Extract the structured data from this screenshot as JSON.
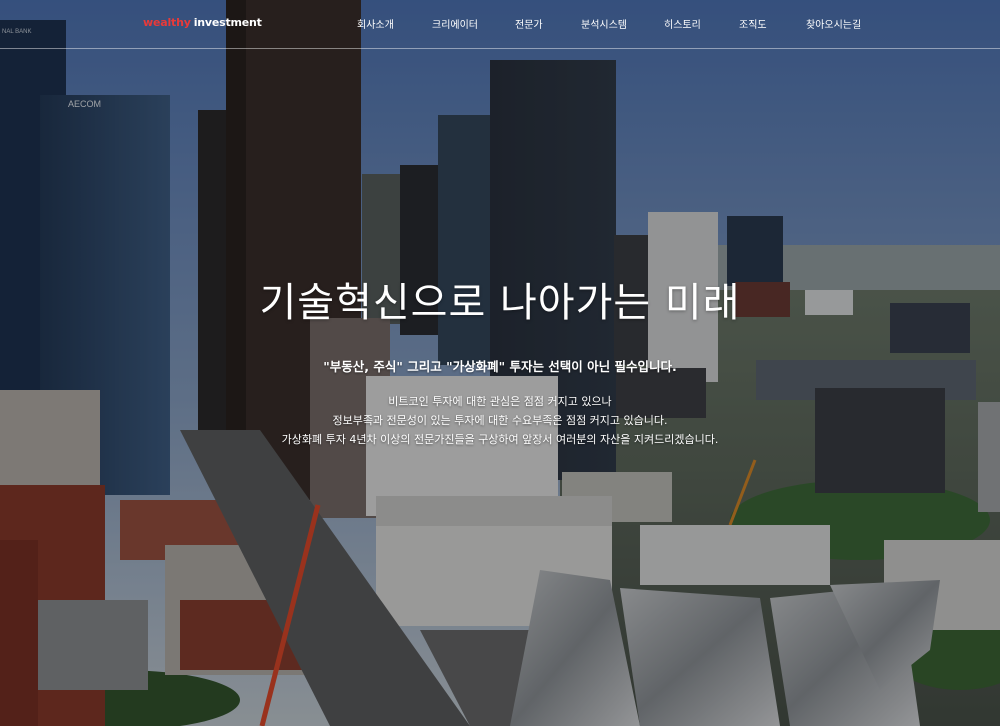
{
  "brand": {
    "part1": "wealthy",
    "part2": "investment",
    "accent_color": "#e83a3a"
  },
  "nav": {
    "items": [
      {
        "label": "회사소개"
      },
      {
        "label": "크리에이터"
      },
      {
        "label": "전문가"
      },
      {
        "label": "분석시스템"
      },
      {
        "label": "히스토리"
      },
      {
        "label": "조직도"
      },
      {
        "label": "찾아오시는길"
      }
    ]
  },
  "hero": {
    "title": "기술혁신으로 나아가는 미래",
    "lead": "\"부동산, 주식\" 그리고 \"가상화폐\" 투자는 선택이 아닌 필수입니다.",
    "lines": [
      "비트코인 투자에 대한 관심은 점점 커지고 있으나",
      "정보부족과 전문성이 있는 투자에 대한 수요부족은 점점 커지고 있습니다.",
      "가상화폐 투자 4년차 이상의 전문가진들을 구상하여 앞장서 여러분의 자산을 지켜드리겠습니다."
    ]
  },
  "background": {
    "building_signs": [
      "AECOM",
      "NAL BANK"
    ]
  }
}
